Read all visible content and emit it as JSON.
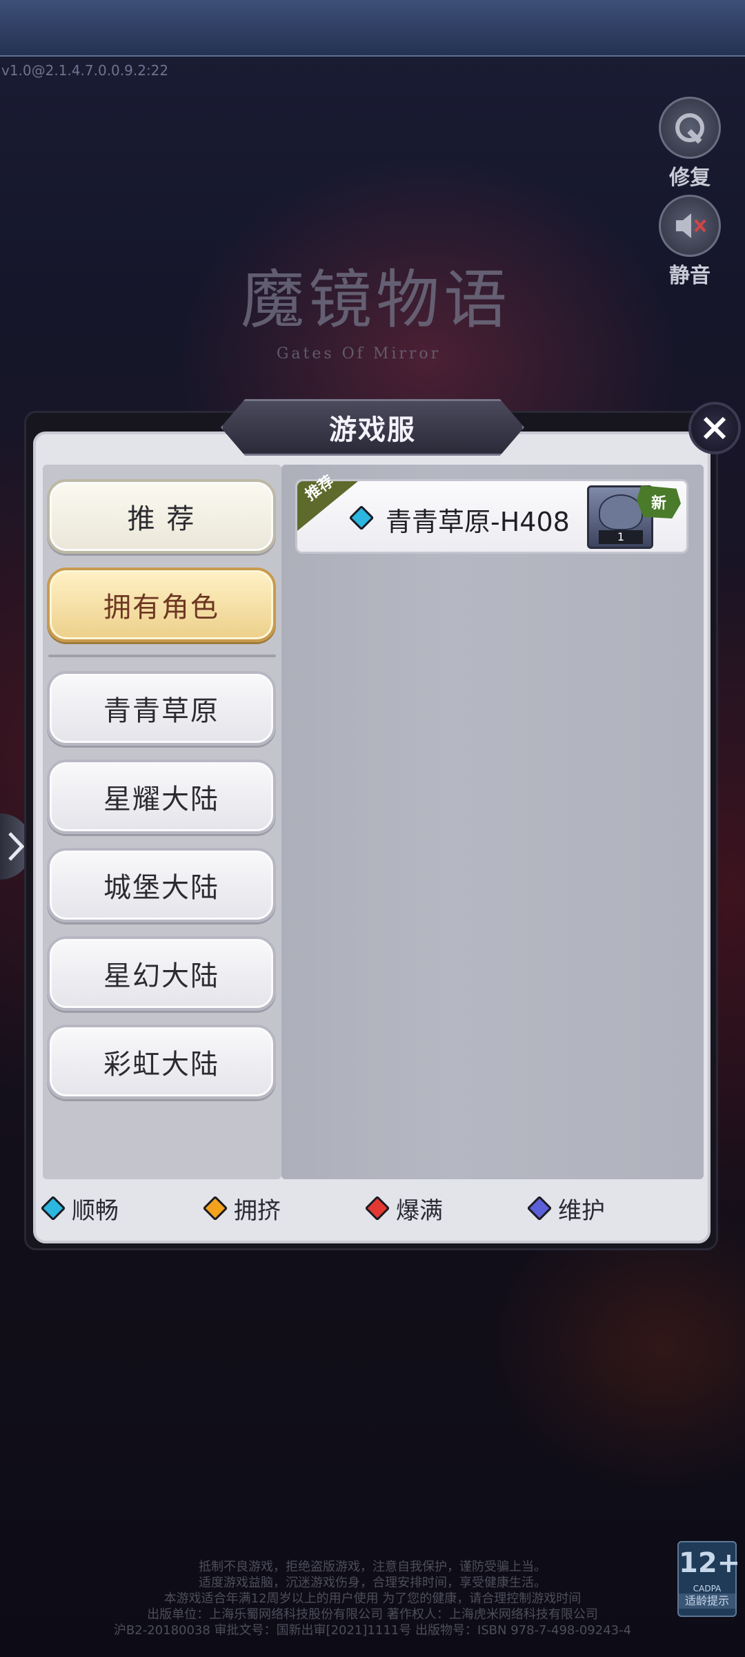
{
  "version": "v1.0@2.1.4.7.0.0.9.2:22",
  "side_buttons": {
    "repair_label": "修复",
    "mute_label": "静音"
  },
  "logo": {
    "title": "魔镜物语",
    "subtitle": "Gates Of Mirror"
  },
  "dialog": {
    "title": "游戏服",
    "categories": [
      {
        "label": "推  荐",
        "state": "default"
      },
      {
        "label": "拥有角色",
        "state": "selected"
      },
      {
        "label": "青青草原",
        "state": "default"
      },
      {
        "label": "星耀大陆",
        "state": "default"
      },
      {
        "label": "城堡大陆",
        "state": "default"
      },
      {
        "label": "星幻大陆",
        "state": "default"
      },
      {
        "label": "彩虹大陆",
        "state": "default"
      }
    ],
    "servers": [
      {
        "ribbon": "推荐",
        "name": "青青草原-H408",
        "status_color": "#2cb7e0",
        "avatar_level": "1",
        "badge": "新"
      }
    ],
    "legend": [
      {
        "label": "顺畅",
        "color": "#2cb7e0"
      },
      {
        "label": "拥挤",
        "color": "#f2a21c"
      },
      {
        "label": "爆满",
        "color": "#e23a33"
      },
      {
        "label": "维护",
        "color": "#5b5fd8"
      }
    ]
  },
  "footer": {
    "lines": [
      "抵制不良游戏，拒绝盗版游戏，注意自我保护，谨防受骗上当。",
      "适度游戏益脑，沉迷游戏伤身，合理安排时间，享受健康生活。",
      "本游戏适合年满12周岁以上的用户使用 为了您的健康，请合理控制游戏时间",
      "出版单位：上海乐蜀网络科技股份有限公司 著作权人：上海虎米网络科技有限公司",
      "沪B2-20180038 审批文号：国新出审[2021]1111号 出版物号：ISBN 978-7-498-09243-4"
    ]
  },
  "age_rating": {
    "age": "12+",
    "org": "CADPA",
    "tip": "适龄提示"
  }
}
